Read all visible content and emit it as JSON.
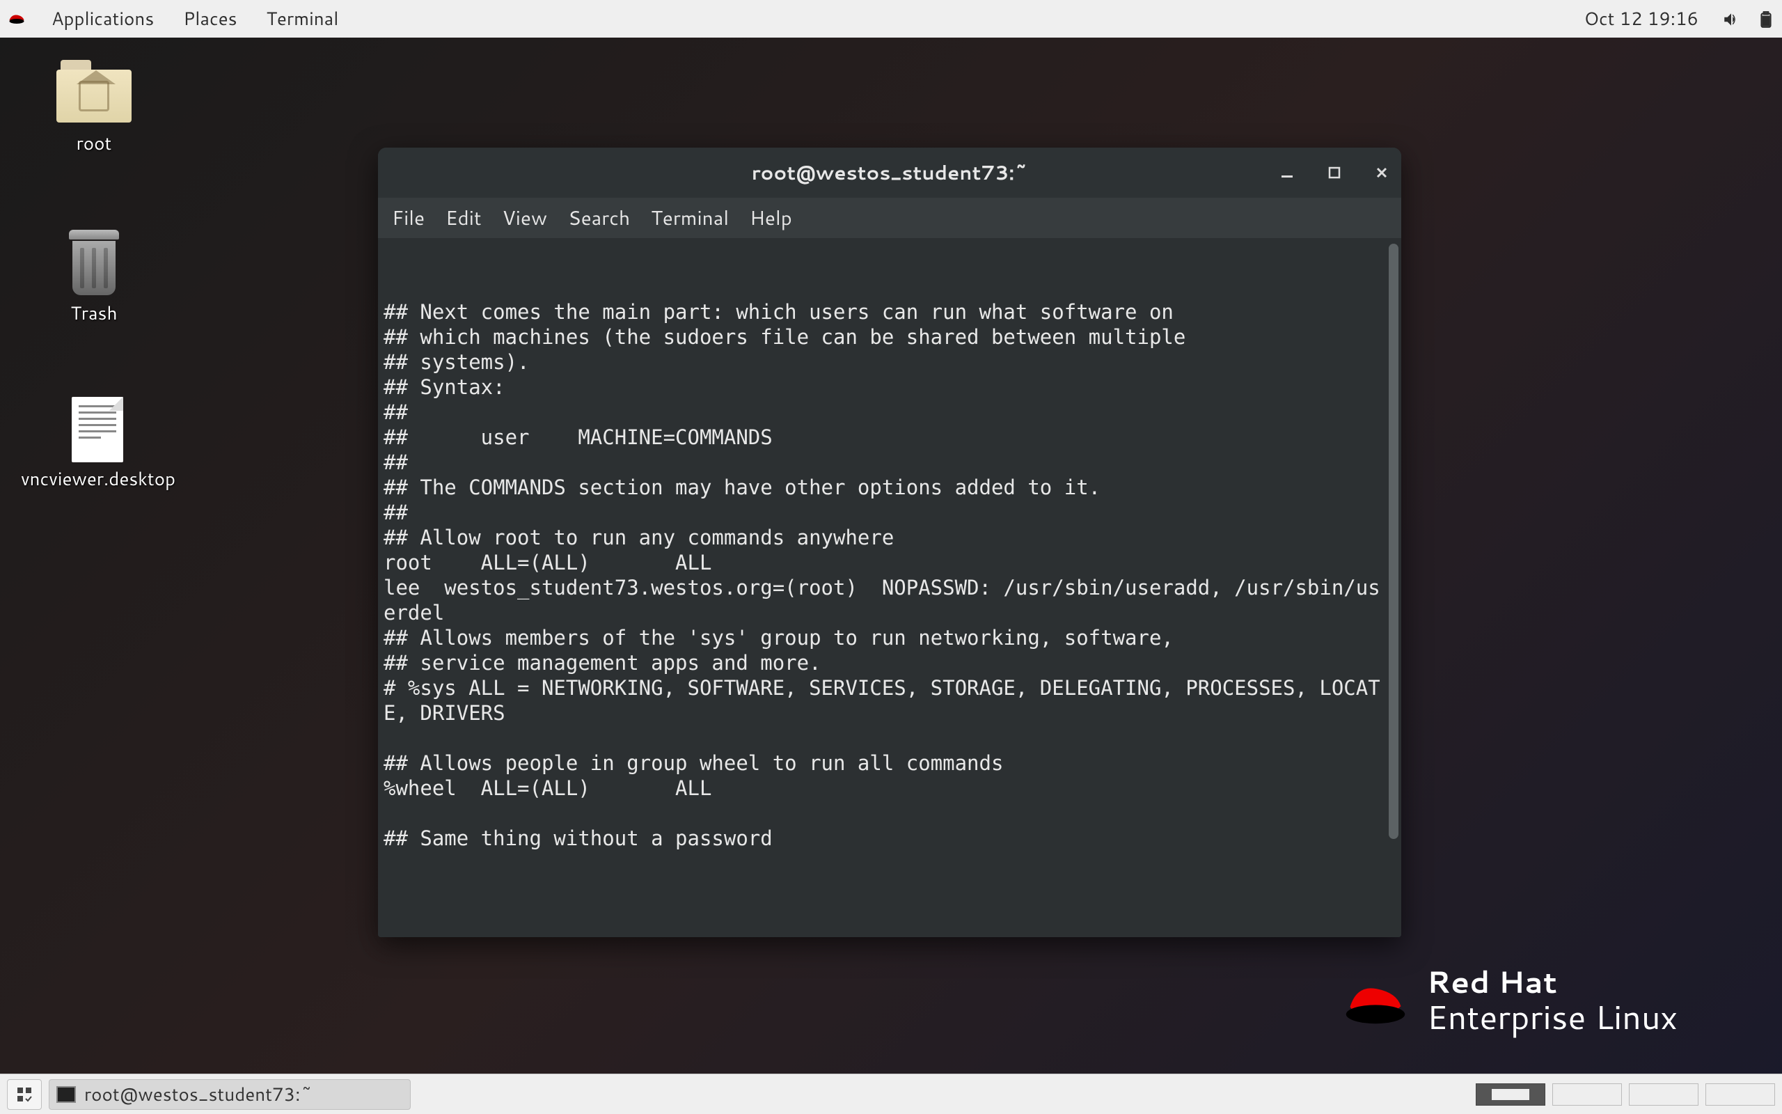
{
  "topbar": {
    "applications": "Applications",
    "places": "Places",
    "terminal": "Terminal",
    "datetime": "Oct 12  19:16"
  },
  "desktop": {
    "root": "root",
    "trash": "Trash",
    "vnc": "vncviewer.desktop"
  },
  "window": {
    "title": "root@westos_student73:~",
    "menu": {
      "file": "File",
      "edit": "Edit",
      "view": "View",
      "search": "Search",
      "terminal": "Terminal",
      "help": "Help"
    }
  },
  "terminal_lines": [
    "## Next comes the main part: which users can run what software on",
    "## which machines (the sudoers file can be shared between multiple",
    "## systems).",
    "## Syntax:",
    "##",
    "##      user    MACHINE=COMMANDS",
    "##",
    "## The COMMANDS section may have other options added to it.",
    "##",
    "## Allow root to run any commands anywhere",
    "root    ALL=(ALL)       ALL",
    "lee  westos_student73.westos.org=(root)  NOPASSWD: /usr/sbin/useradd, /usr/sbin/userdel",
    "## Allows members of the 'sys' group to run networking, software,",
    "## service management apps and more.",
    "# %sys ALL = NETWORKING, SOFTWARE, SERVICES, STORAGE, DELEGATING, PROCESSES, LOCATE, DRIVERS",
    "",
    "## Allows people in group wheel to run all commands",
    "%wheel  ALL=(ALL)       ALL",
    "",
    "## Same thing without a password"
  ],
  "watermark": {
    "top": "Red Hat",
    "bottom": "Enterprise Linux"
  },
  "taskbar": {
    "task": "root@westos_student73:~"
  }
}
